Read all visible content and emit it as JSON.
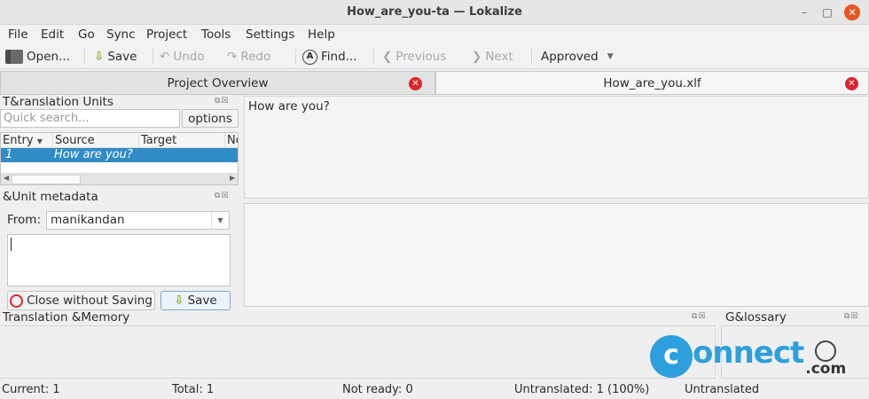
{
  "window": {
    "title": "How_are_you-ta — Lokalize",
    "minimize": "–",
    "maximize": "□",
    "close": "✕"
  },
  "menu": [
    "File",
    "Edit",
    "Go",
    "Sync",
    "Project",
    "Tools",
    "Settings",
    "Help"
  ],
  "toolbar": {
    "open": "Open...",
    "save": "Save",
    "undo": "Undo",
    "redo": "Redo",
    "find": "Find...",
    "previous": "Previous",
    "next": "Next",
    "state": "Approved"
  },
  "tabs": [
    {
      "label": "Project Overview",
      "active": false
    },
    {
      "label": "How_are_you.xlf",
      "active": true
    }
  ],
  "units": {
    "title": "T&ranslation Units",
    "search_placeholder": "Quick search...",
    "options": "options",
    "columns": [
      "Entry",
      "Source",
      "Target",
      "Notes"
    ],
    "rows": [
      {
        "entry": "1",
        "source": "How are you?",
        "target": ""
      }
    ]
  },
  "metadata": {
    "title": "&Unit metadata",
    "from_label": "From:",
    "from_value": "manikandan",
    "note": "",
    "close_button": "Close without Saving",
    "save_button": "Save"
  },
  "editor": {
    "source": "How are you?",
    "target": ""
  },
  "tm": {
    "title": "Translation &Memory"
  },
  "glossary": {
    "title": "G&lossary"
  },
  "status": {
    "current": "Current: 1",
    "total": "Total: 1",
    "not_ready": "Not ready: 0",
    "untranslated": "Untranslated: 1 (100%)",
    "state": "Untranslated"
  },
  "watermark": {
    "text": "Connect",
    "suffix": ".com",
    "color": "#2c9fdc"
  },
  "colors": {
    "selection": "#308cc6",
    "close_red": "#d9262e",
    "window_close": "#e95420"
  }
}
